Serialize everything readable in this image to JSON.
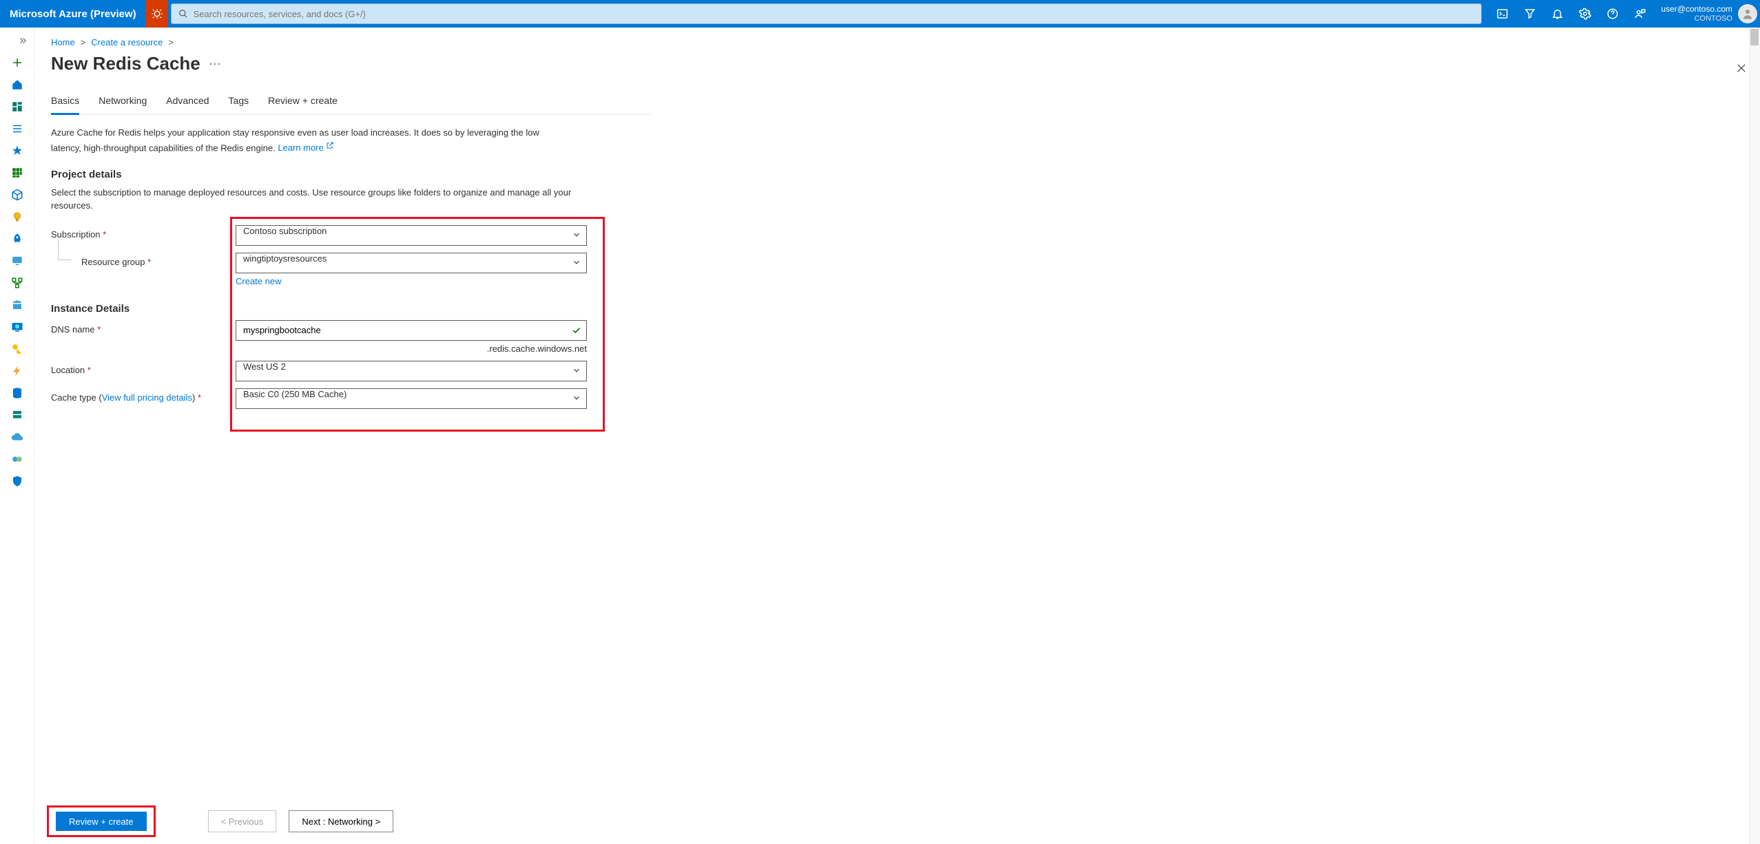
{
  "topbar": {
    "brand": "Microsoft Azure (Preview)",
    "search_placeholder": "Search resources, services, and docs (G+/)",
    "user_email": "user@contoso.com",
    "tenant": "CONTOSO"
  },
  "breadcrumb": {
    "home": "Home",
    "create": "Create a resource"
  },
  "page": {
    "title": "New Redis Cache"
  },
  "tabs": {
    "basics": "Basics",
    "networking": "Networking",
    "advanced": "Advanced",
    "tags": "Tags",
    "review": "Review + create"
  },
  "desc": {
    "text1": "Azure Cache for Redis helps your application stay responsive even as user load increases. It does so by leveraging the low latency, high-throughput capabilities of the Redis engine.  ",
    "learn_more": "Learn more"
  },
  "sections": {
    "project_details": "Project details",
    "project_sub": "Select the subscription to manage deployed resources and costs. Use resource groups like folders to organize and manage all your resources.",
    "instance_details": "Instance Details"
  },
  "form": {
    "subscription_label": "Subscription",
    "subscription_value": "Contoso subscription",
    "resource_group_label": "Resource group",
    "resource_group_value": "wingtiptoysresources",
    "create_new": "Create new",
    "dns_label": "DNS name",
    "dns_value": "myspringbootcache",
    "dns_suffix": ".redis.cache.windows.net",
    "location_label": "Location",
    "location_value": "West US 2",
    "cache_type_label": "Cache type",
    "cache_type_link": "View full pricing details",
    "cache_type_value": "Basic C0 (250 MB Cache)"
  },
  "footer": {
    "review": "Review + create",
    "previous": "< Previous",
    "next": "Next : Networking >"
  }
}
